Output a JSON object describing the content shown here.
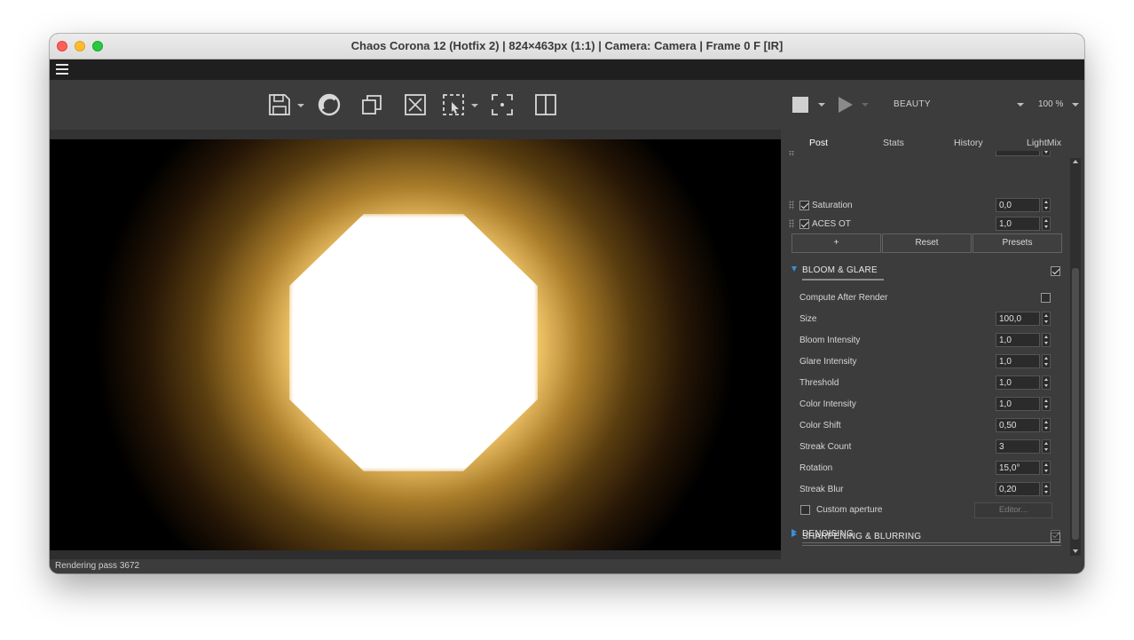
{
  "window": {
    "title": "Chaos Corona 12 (Hotfix 2) | 824×463px (1:1) | Camera: Camera | Frame 0 F [IR]"
  },
  "toolbar": {
    "left_icons": [
      "save-icon",
      "corona-logo-icon",
      "copy-icon",
      "clear-icon",
      "region-select-icon",
      "focus-icon",
      "compare-icon"
    ],
    "right_icons": [
      "stop-icon",
      "play-icon"
    ],
    "pass_select": "BEAUTY",
    "zoom": "100 %"
  },
  "panel": {
    "tabs": [
      "Post",
      "Stats",
      "History",
      "LightMix"
    ],
    "active_tab": "Post",
    "tone_rows": [
      {
        "label": "Saturation",
        "value": "0,0",
        "checked": true
      },
      {
        "label": "ACES OT",
        "value": "1,0",
        "checked": true
      }
    ],
    "buttons": {
      "add": "+",
      "reset": "Reset",
      "presets": "Presets"
    },
    "bloom_glare": {
      "title": "BLOOM & GLARE",
      "enabled": true,
      "compute_after_render": "Compute After Render",
      "params": [
        {
          "label": "Size",
          "value": "100,0"
        },
        {
          "label": "Bloom Intensity",
          "value": "1,0"
        },
        {
          "label": "Glare Intensity",
          "value": "1,0"
        },
        {
          "label": "Threshold",
          "value": "1,0"
        },
        {
          "label": "Color Intensity",
          "value": "1,0"
        },
        {
          "label": "Color Shift",
          "value": "0,50"
        },
        {
          "label": "Streak Count",
          "value": "3"
        },
        {
          "label": "Rotation",
          "value": "15,0°"
        },
        {
          "label": "Streak Blur",
          "value": "0,20"
        }
      ],
      "custom_aperture": "Custom aperture",
      "editor": "Editor..."
    },
    "sharpening": {
      "title": "SHARPENING & BLURRING",
      "enabled": false
    },
    "denoising": {
      "title": "DENOISING",
      "enabled": true
    }
  },
  "status": {
    "text": "Rendering pass 3672"
  },
  "colors": {
    "panel_bg": "#3c3c3c",
    "accent": "#3a8fd8",
    "menubar": "#1f1f1f"
  }
}
